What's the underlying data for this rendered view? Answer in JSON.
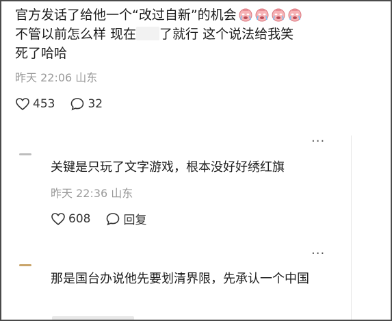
{
  "main_comment": {
    "text_part1": "官方发话了给他一个“改过自新”的机会",
    "emoji_count": 4,
    "emoji_name": "crying-face-emoji",
    "text_line2_a": "不管以前怎么样 现在",
    "text_line2_b": "了就行 这个说法给我笑",
    "text_line3": "死了哈哈",
    "time": "昨天 22:06",
    "location": "山东",
    "likes": "453",
    "comments": "32"
  },
  "reply1": {
    "text": "关键是只玩了文字游戏，根本没好好绣红旗",
    "time": "昨天 22:36",
    "location": "山东",
    "likes": "608",
    "reply_label": "回复"
  },
  "reply2": {
    "text": "那是国台办说他先要划清界限，先承认一个中国"
  },
  "more_label": "···",
  "colors": {
    "text": "#1d1d1d",
    "meta": "#999999",
    "border": "#4a4a4a",
    "emoji": "#f4a3a8"
  }
}
